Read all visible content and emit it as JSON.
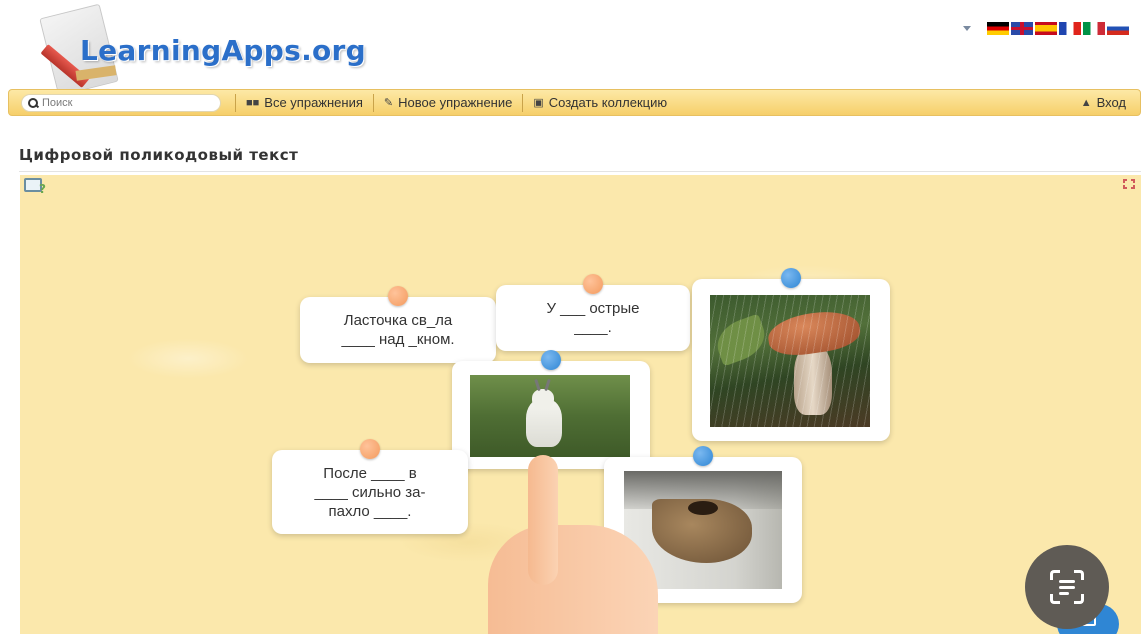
{
  "header": {
    "logo_text": "LearningApps.org",
    "languages": [
      "de",
      "en",
      "es",
      "fr",
      "it",
      "ru"
    ]
  },
  "navbar": {
    "search_placeholder": "Поиск",
    "all_exercises": "Все упражнения",
    "new_exercise": "Новое упражнение",
    "create_collection": "Создать коллекцию",
    "login": "Вход"
  },
  "page": {
    "title": "Цифровой поликодовый текст"
  },
  "app": {
    "text_cards": [
      {
        "line1": "Ласточка св_ла",
        "line2": "____ над _кном.",
        "line3": "",
        "pin": "orange"
      },
      {
        "line1": "У ___ острые",
        "line2": "____.",
        "line3": "",
        "pin": "orange"
      },
      {
        "line1": "После ____ в",
        "line2": "____ сильно за-",
        "line3": "пахло ____.",
        "pin": "orange"
      }
    ],
    "image_cards": [
      {
        "subject": "mushroom",
        "pin": "blue"
      },
      {
        "subject": "goat",
        "pin": "blue"
      },
      {
        "subject": "swallow-nest",
        "pin": "blue"
      }
    ],
    "colors": {
      "background": "#fbe8ac",
      "pin_orange": "#f39a5e",
      "pin_blue": "#2f86d4",
      "navbar": "#f6cf6a"
    }
  },
  "icons": {
    "search": "search-icon",
    "grid": "grid-icon",
    "pencil": "pencil-icon",
    "collection": "collection-icon",
    "user": "user-icon",
    "help": "help-icon",
    "fullscreen": "fullscreen-icon",
    "scan": "scan-icon",
    "check": "check-icon"
  }
}
